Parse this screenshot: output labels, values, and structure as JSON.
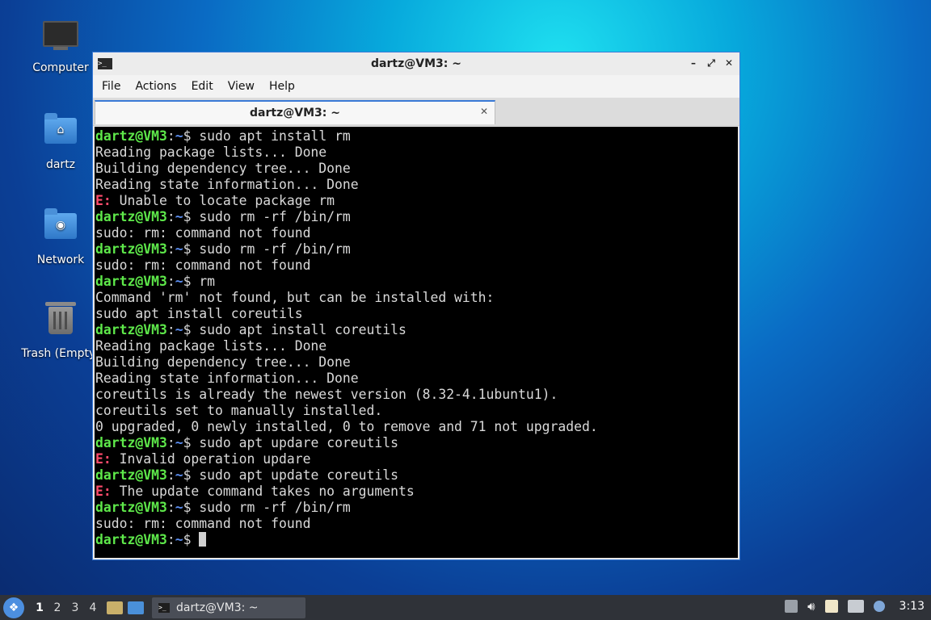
{
  "desktop": {
    "icons": [
      {
        "label": "Computer"
      },
      {
        "label": "dartz"
      },
      {
        "label": "Network"
      },
      {
        "label": "Trash (Empty)"
      }
    ]
  },
  "window": {
    "title": "dartz@VM3: ~",
    "menu": [
      "File",
      "Actions",
      "Edit",
      "View",
      "Help"
    ],
    "tab_label": "dartz@VM3: ~"
  },
  "terminal": {
    "prompt_user": "dartz@VM3",
    "prompt_path": "~",
    "lines": [
      {
        "kind": "cmd",
        "text": "sudo apt install rm"
      },
      {
        "kind": "out",
        "text": "Reading package lists... Done"
      },
      {
        "kind": "out",
        "text": "Building dependency tree... Done"
      },
      {
        "kind": "out",
        "text": "Reading state information... Done"
      },
      {
        "kind": "err",
        "text": "Unable to locate package rm"
      },
      {
        "kind": "cmd",
        "text": "sudo rm -rf /bin/rm"
      },
      {
        "kind": "out",
        "text": "sudo: rm: command not found"
      },
      {
        "kind": "cmd",
        "text": "sudo rm -rf /bin/rm"
      },
      {
        "kind": "out",
        "text": "sudo: rm: command not found"
      },
      {
        "kind": "cmd",
        "text": "rm"
      },
      {
        "kind": "out",
        "text": "Command 'rm' not found, but can be installed with:"
      },
      {
        "kind": "out",
        "text": "sudo apt install coreutils"
      },
      {
        "kind": "cmd",
        "text": "sudo apt install coreutils"
      },
      {
        "kind": "out",
        "text": "Reading package lists... Done"
      },
      {
        "kind": "out",
        "text": "Building dependency tree... Done"
      },
      {
        "kind": "out",
        "text": "Reading state information... Done"
      },
      {
        "kind": "out",
        "text": "coreutils is already the newest version (8.32-4.1ubuntu1)."
      },
      {
        "kind": "out",
        "text": "coreutils set to manually installed."
      },
      {
        "kind": "out",
        "text": "0 upgraded, 0 newly installed, 0 to remove and 71 not upgraded."
      },
      {
        "kind": "cmd",
        "text": "sudo apt updare coreutils"
      },
      {
        "kind": "err",
        "text": "Invalid operation updare"
      },
      {
        "kind": "cmd",
        "text": "sudo apt update coreutils"
      },
      {
        "kind": "err",
        "text": "The update command takes no arguments"
      },
      {
        "kind": "cmd",
        "text": "sudo rm -rf /bin/rm"
      },
      {
        "kind": "out",
        "text": "sudo: rm: command not found"
      },
      {
        "kind": "cursor",
        "text": ""
      }
    ],
    "error_prefix": "E:",
    "colors": {
      "prompt": "#5ee84a",
      "path": "#5c8ff2",
      "error": "#ff4b6b",
      "text": "#d9d9d9"
    }
  },
  "taskbar": {
    "workspaces": [
      "1",
      "2",
      "3",
      "4"
    ],
    "active_workspace": "1",
    "task_label": "dartz@VM3: ~",
    "clock": "3:13"
  }
}
